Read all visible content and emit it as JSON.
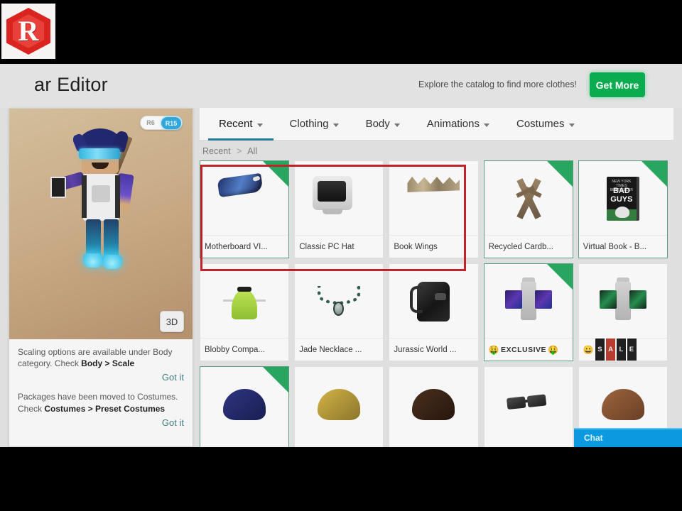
{
  "header": {
    "title": "ar Editor",
    "catalog_message": "Explore the catalog to find more clothes!",
    "get_more_label": "Get More",
    "logo_letter": "R"
  },
  "avatar_panel": {
    "rig_options": [
      {
        "label": "R6",
        "selected": false
      },
      {
        "label": "R15",
        "selected": true
      }
    ],
    "view_3d_label": "3D",
    "hints": [
      {
        "text_before": "Scaling options are available under Body category. Check ",
        "text_bold": "Body > Scale",
        "dismiss_label": "Got it"
      },
      {
        "text_before": "Packages have been moved to Costumes. Check ",
        "text_bold": "Costumes > Preset Costumes",
        "dismiss_label": "Got it"
      }
    ]
  },
  "tabs": [
    {
      "label": "Recent",
      "active": true
    },
    {
      "label": "Clothing",
      "active": false
    },
    {
      "label": "Body",
      "active": false
    },
    {
      "label": "Animations",
      "active": false
    },
    {
      "label": "Costumes",
      "active": false
    }
  ],
  "breadcrumb": {
    "root": "Recent",
    "separator": ">",
    "current": "All"
  },
  "items": [
    {
      "label": "Motherboard VI...",
      "owned": true,
      "art": "motherboard"
    },
    {
      "label": "Classic PC Hat",
      "owned": false,
      "art": "crt"
    },
    {
      "label": "Book Wings",
      "owned": false,
      "art": "wings"
    },
    {
      "label": "Recycled Cardb...",
      "owned": true,
      "art": "swords"
    },
    {
      "label": "Virtual Book - B...",
      "owned": true,
      "art": "badbook"
    },
    {
      "label": "Blobby Compa...",
      "owned": false,
      "art": "blobby"
    },
    {
      "label": "Jade Necklace ...",
      "owned": false,
      "art": "necklace"
    },
    {
      "label": "Jurassic World ...",
      "owned": false,
      "art": "backpack"
    },
    {
      "label": "EXCLUSIVE",
      "owned": true,
      "art": "shirt-purple",
      "badge_style": "exclusive"
    },
    {
      "label": "S A L E",
      "owned": false,
      "art": "shirt-green",
      "badge_style": "sale"
    },
    {
      "label": "",
      "owned": true,
      "art": "hair-blue"
    },
    {
      "label": "",
      "owned": false,
      "art": "hair-blonde"
    },
    {
      "label": "",
      "owned": false,
      "art": "hair-brown"
    },
    {
      "label": "",
      "owned": false,
      "art": "glasses"
    },
    {
      "label": "",
      "owned": false,
      "art": "hair-lbrown"
    }
  ],
  "badge_tiles": {
    "exclusive_text": "EXCLUSIVE",
    "sale_letters": [
      "S",
      "A",
      "L",
      "E"
    ]
  },
  "chat": {
    "label": "Chat"
  },
  "book_cover": {
    "tiny_line": "NEW YORK TIMES BESTSELLER",
    "line1": "BAD",
    "line2": "GUYS"
  },
  "colors": {
    "accent_green": "#00b04b",
    "owned_border": "#57a07f",
    "corner_badge": "#1fa85c",
    "tab_underline": "#1a7f9e",
    "selection_red": "#c0232b",
    "chat_blue": "#0b9ae0",
    "logo_red": "#d9241f"
  }
}
